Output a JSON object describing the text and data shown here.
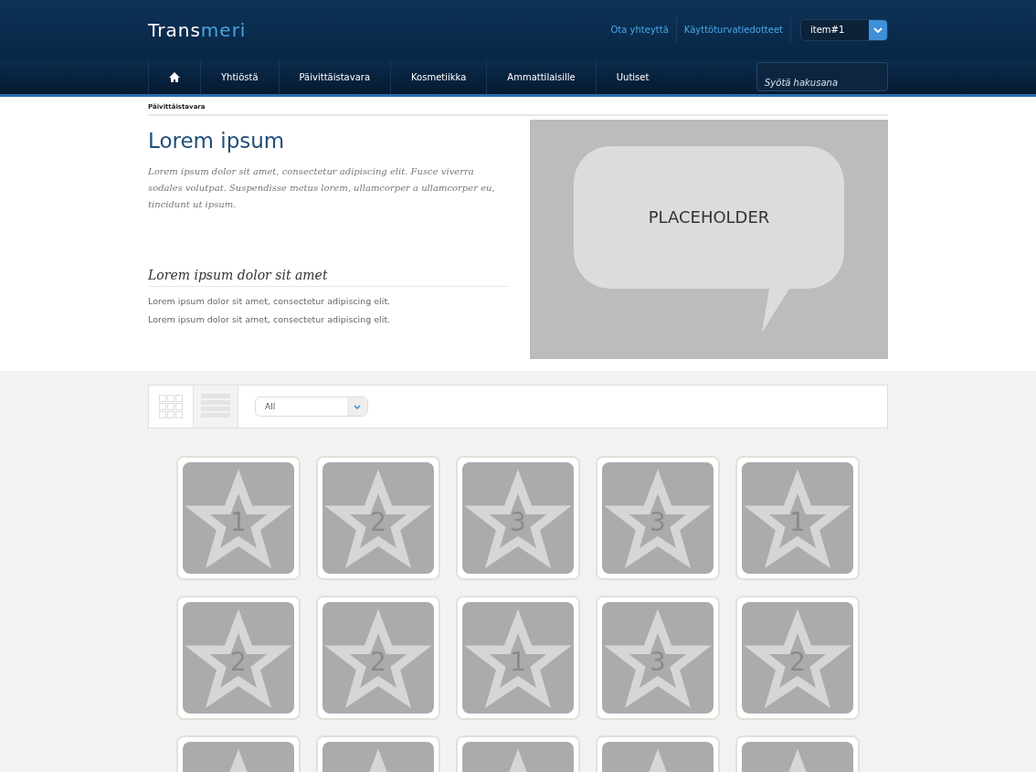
{
  "header": {
    "logo": {
      "part_1": "Trans",
      "part_2": "meri"
    },
    "links": [
      "Ota yhteyttä",
      "Käyttöturvatiedotteet"
    ],
    "selector": {
      "value": "item#1"
    }
  },
  "nav": {
    "items": [
      {
        "kind": "home",
        "selected": false
      },
      {
        "label": "Yhtiöstä",
        "selected": false
      },
      {
        "label": "Päivittäistavara",
        "selected": false
      },
      {
        "label": "Kosmetiikka",
        "selected": false
      },
      {
        "label": "Ammattilaisille",
        "selected": false
      },
      {
        "label": "Uutiset",
        "selected": false
      }
    ],
    "search": {
      "placeholder": "Syötä hakusana"
    }
  },
  "breadcrumb": "Päivittäistavara",
  "hero": {
    "title": "Lorem ipsum",
    "intro": "Lorem ipsum dolor sit amet, consectetur adipiscing elit. Fusce viverra sodales volutpat. Suspendisse metus lorem, ullamcorper a ullamcorper eu, tincidunt ut ipsum.",
    "subtitle": "Lorem ipsum dolor sit amet",
    "lines": [
      "Lorem ipsum dolor sit amet, consectetur adipiscing elit.",
      "Lorem ipsum dolor sit amet, consectetur adipiscing elit."
    ],
    "image_label": "PLACEHOLDER"
  },
  "toolbar": {
    "views": [
      {
        "kind": "grid",
        "selected": true
      },
      {
        "kind": "list",
        "selected": false
      }
    ],
    "filter": {
      "value": "All"
    }
  },
  "tiles": [
    {
      "kind": "numbered",
      "number": "1"
    },
    {
      "kind": "numbered",
      "number": "2"
    },
    {
      "kind": "numbered",
      "number": "3"
    },
    {
      "kind": "numbered",
      "number": "3"
    },
    {
      "kind": "numbered",
      "number": "1"
    },
    {
      "kind": "numbered",
      "number": "2"
    },
    {
      "kind": "numbered",
      "number": "2"
    },
    {
      "kind": "numbered",
      "number": "1"
    },
    {
      "kind": "numbered",
      "number": "3"
    },
    {
      "kind": "numbered",
      "number": "2"
    },
    {
      "kind": "cut"
    },
    {
      "kind": "cut"
    },
    {
      "kind": "cut"
    },
    {
      "kind": "cut"
    },
    {
      "kind": "cut"
    }
  ]
}
